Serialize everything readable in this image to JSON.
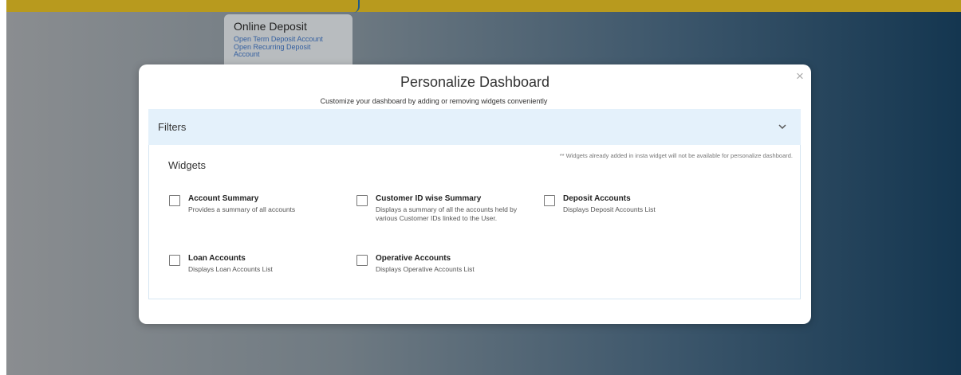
{
  "background": {
    "card": {
      "title": "Online Deposit",
      "links": [
        "Open Term Deposit Account",
        "Open Recurring Deposit",
        "Account"
      ]
    }
  },
  "modal": {
    "title": "Personalize Dashboard",
    "subtitle": "Customize your dashboard by adding or removing widgets conveniently",
    "close_icon": "×",
    "filters_label": "Filters",
    "widgets_title": "Widgets",
    "widgets_note": "** Widgets already added in insta widget will not be available for personalize dashboard.",
    "widgets": [
      {
        "title": "Account Summary",
        "desc": "Provides a summary of all accounts",
        "checked": false
      },
      {
        "title": "Customer ID wise Summary",
        "desc": "Displays a summary of all the accounts held by various Customer IDs linked to the User.",
        "checked": false
      },
      {
        "title": "Deposit Accounts",
        "desc": "Displays Deposit Accounts List",
        "checked": false
      },
      {
        "title": "Loan Accounts",
        "desc": "Displays Loan Accounts List",
        "checked": false
      },
      {
        "title": "Operative Accounts",
        "desc": "Displays Operative Accounts List",
        "checked": false
      }
    ]
  },
  "colors": {
    "topbar": "#b89a1e",
    "filters_bg": "#e4f1fb",
    "link": "#3560a0"
  }
}
